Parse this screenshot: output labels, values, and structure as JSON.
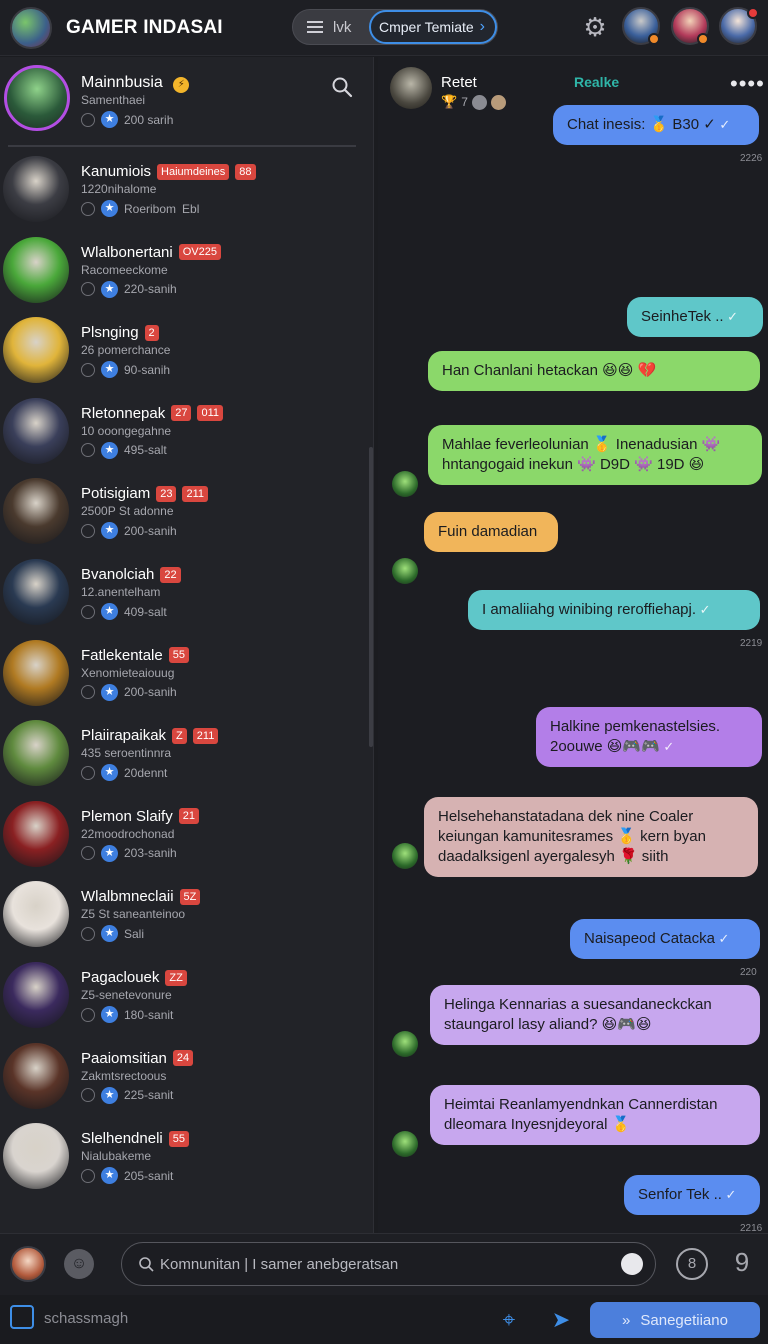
{
  "header": {
    "title": "GAMER INDASAI",
    "seg_left_label": "lvk",
    "seg_right_label": "Cmper Temiate",
    "colors": {
      "accent": "#3e8ee6",
      "badge": "#f08a2a"
    }
  },
  "profile": {
    "name": "Mainnbusia",
    "subtitle": "Samenthaei",
    "stat": "200 sarih"
  },
  "contacts": [
    {
      "name": "Kanumiois",
      "badge": "Haiumdeines",
      "badge2": "88",
      "sub": "1220nihalome",
      "stat": "Roeribom",
      "stat2": "Ebl",
      "color": "#3c3d44"
    },
    {
      "name": "Wlalbonertani",
      "badge": "OV225",
      "sub": "Racomeeckome",
      "stat": "220-sanih",
      "color": "#4aa83a"
    },
    {
      "name": "Plsnging",
      "badge": "2",
      "sub": "26 pomerchance",
      "stat": "90-sanih",
      "color": "#e0b43a"
    },
    {
      "name": "Rletonnepak",
      "badge": "27",
      "badge2": "011",
      "sub": "10 ooongegahne",
      "stat": "495-salt",
      "color": "#3a3f5a"
    },
    {
      "name": "Potisigiam",
      "badge": "23",
      "badge2": "211",
      "sub": "2500P St adonne",
      "stat": "200-sanih",
      "color": "#4a3a2e"
    },
    {
      "name": "Bvanolciah",
      "badge": "22",
      "sub": "12.anentelham",
      "stat": "409-salt",
      "color": "#2a3a52"
    },
    {
      "name": "Fatlekentale",
      "badge": "55",
      "sub": "Xenomieteaiouug",
      "stat": "200-sanih",
      "color": "#b07a22"
    },
    {
      "name": "Plaiirapaikak",
      "badge": "Z",
      "badge2": "211",
      "sub": "435 seroentinnra",
      "stat": "20dennt",
      "color": "#5f8a3e"
    },
    {
      "name": "Plemon Slaify",
      "badge": "21",
      "sub": "22moodrochonad",
      "stat": "203-sanih",
      "color": "#8a2022"
    },
    {
      "name": "Wlalbmneclaii",
      "badge": "5Z",
      "sub": "Z5 St saneanteinoo",
      "stat": "Sali",
      "color": "#e8e2dc"
    },
    {
      "name": "Pagaclouek",
      "badge": "ZZ",
      "sub": "Z5-senetevonure",
      "stat": "180-sanit",
      "color": "#3b2a5e"
    },
    {
      "name": "Paaiomsitian",
      "badge": "24",
      "sub": "Zakmtsrectoous",
      "stat": "225-sanit",
      "color": "#5a3428"
    },
    {
      "name": "Slelhendneli",
      "badge": "55",
      "sub": "Nialubakeme",
      "stat": "205-sanit",
      "color": "#d9d4cf"
    }
  ],
  "chat_header": {
    "name": "Retet",
    "sub": "7",
    "status": "Realke",
    "more": "••••"
  },
  "messages": [
    {
      "text": "Chat inesis: 🥇 B30 ✓",
      "time": "2226",
      "color": "#5b8df0"
    },
    {
      "text": "SeinheTek ..",
      "time": "",
      "color": "#5fc7c9"
    },
    {
      "text": "Han Chanlani hetackan 😆😆 💔",
      "time": "",
      "color": "#8bd86a"
    },
    {
      "text": "Mahlae feverleolunian 🥇 Inenadusian 👾 hntangogaid inekun 👾 D9D 👾 19D 😆",
      "time": "",
      "color": "#8bd86a"
    },
    {
      "text": "Fuin damadian",
      "time": "",
      "color": "#f1b55a"
    },
    {
      "text": "I amaliiahg winibing reroffiehapj.",
      "time": "2219",
      "color": "#5fc7c9"
    },
    {
      "text": "Halkine pemkenastelsies. 2oouwe 😆🎮🎮",
      "time": "",
      "color": "#b37ee8"
    },
    {
      "text": "Helsehehanstatadana dek nine Coaler keiungan kamunitesrames 🥇 kern byan daadalksigenl ayergalesyh 🌹 siith",
      "time": "",
      "color": "#d6b2b2"
    },
    {
      "text": "Naisapeod Catacka",
      "time": "220",
      "color": "#5b8df0"
    },
    {
      "text": "Helinga Kennarias a suesandaneckckan staungarol lasy aliand? 😆🎮😆",
      "time": "",
      "color": "#c7a7ee"
    },
    {
      "text": "Heimtai Reanlamyendnkan Cannerdistan dleomara Inyesnjdeyoral 🥇",
      "time": "",
      "color": "#c7a7ee"
    },
    {
      "text": "Senfor Tek ..",
      "time": "2216",
      "color": "#5b8df0"
    }
  ],
  "composer": {
    "placeholder": "Komnunitan | I samer anebgeratsan",
    "btn_a": "8",
    "btn_b": "9"
  },
  "bottombar": {
    "label": "schassmagh",
    "primary": "Sanegetiiano"
  }
}
